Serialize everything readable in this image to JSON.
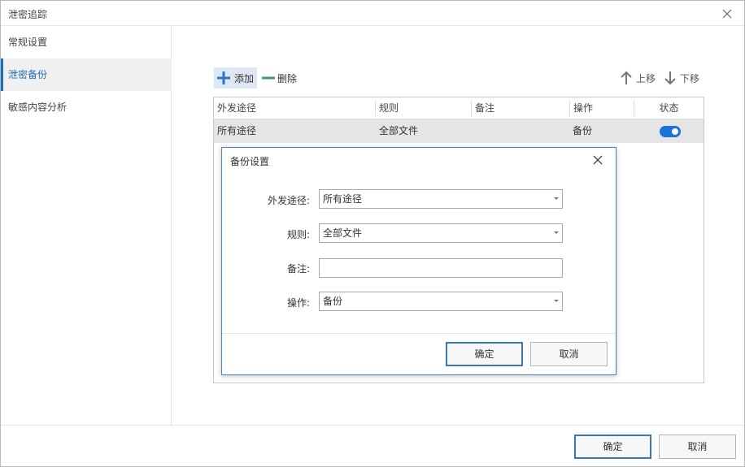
{
  "window": {
    "title": "泄密追踪"
  },
  "sidebar": {
    "items": [
      {
        "label": "常规设置",
        "active": false
      },
      {
        "label": "泄密备份",
        "active": true
      },
      {
        "label": "敏感内容分析",
        "active": false
      }
    ]
  },
  "toolbar": {
    "add_label": "添加",
    "delete_label": "删除",
    "move_up_label": "上移",
    "move_down_label": "下移"
  },
  "table": {
    "columns": [
      "外发途径",
      "规则",
      "备注",
      "操作",
      "状态"
    ],
    "rows": [
      {
        "channel": "所有途径",
        "rule": "全部文件",
        "note": "",
        "action": "备份",
        "enabled": true
      }
    ]
  },
  "dialog": {
    "title": "备份设置",
    "fields": {
      "channel": {
        "label": "外发途径:",
        "value": "所有途径"
      },
      "rule": {
        "label": "规则:",
        "value": "全部文件"
      },
      "note": {
        "label": "备注:",
        "value": ""
      },
      "action": {
        "label": "操作:",
        "value": "备份"
      }
    },
    "ok_label": "确定",
    "cancel_label": "取消"
  },
  "footer": {
    "ok_label": "确定",
    "cancel_label": "取消"
  },
  "colors": {
    "accent": "#1f6fb5",
    "toggle_on": "#1a73d9",
    "add_icon": "#2a73c8",
    "delete_icon": "#3a9a6a"
  }
}
